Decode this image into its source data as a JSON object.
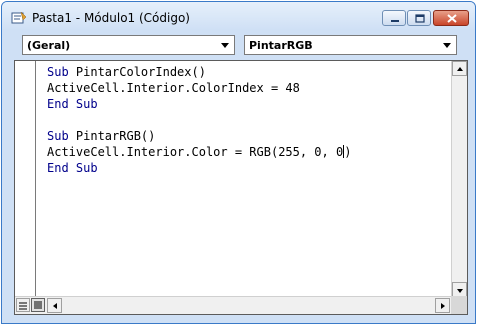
{
  "window": {
    "title": "Pasta1 - Módulo1 (Código)",
    "controls": [
      "minimize-icon",
      "maximize-icon",
      "close-icon"
    ]
  },
  "toolbar": {
    "object_dropdown": "(Geral)",
    "procedure_dropdown": "PintarRGB"
  },
  "code": {
    "lines": [
      {
        "kw1": "Sub",
        "rest": " PintarColorIndex()"
      },
      {
        "text": "ActiveCell.Interior.ColorIndex = 48"
      },
      {
        "kw1": "End",
        "kw2": "Sub"
      },
      {
        "text": ""
      },
      {
        "kw1": "Sub",
        "rest": " PintarRGB()"
      },
      {
        "text_before_caret": "ActiveCell.Interior.Color = RGB(255, 0, 0",
        "text_after_caret": ")"
      },
      {
        "kw1": "End",
        "kw2": "Sub"
      }
    ]
  },
  "colors": {
    "keyword": "#00008b",
    "titlebar": "#cfe0f5",
    "close_button": "#c9452a"
  }
}
